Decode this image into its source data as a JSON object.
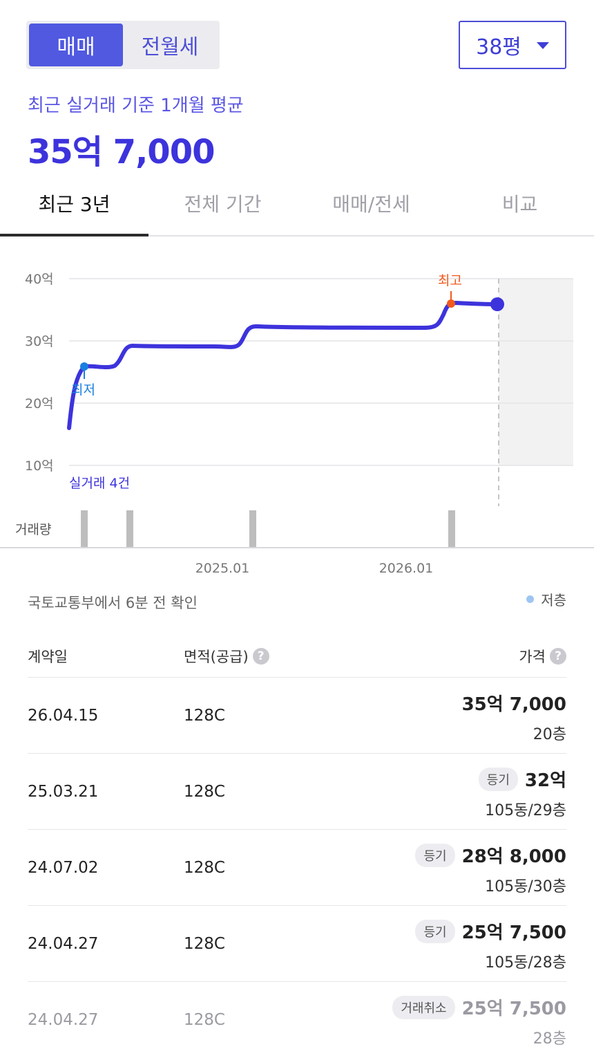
{
  "trade_toggle": {
    "sale": "매매",
    "rent": "전월세"
  },
  "size_select": {
    "value": "38평"
  },
  "summary": {
    "label": "최근 실거래 기준 1개월 평균",
    "price": "35억 7,000"
  },
  "period_tabs": [
    "최근 3년",
    "전체 기간",
    "매매/전세",
    "비교"
  ],
  "chart_data": {
    "type": "line",
    "y_axis": {
      "ticks": [
        "40억",
        "30억",
        "20억",
        "10억"
      ],
      "values": [
        40,
        30,
        20,
        10
      ],
      "unit": "억"
    },
    "x_axis": {
      "ticks": [
        "2025.01",
        "2026.01"
      ]
    },
    "series": [
      {
        "values_eok": [
          16,
          26,
          26,
          29,
          29,
          32,
          32,
          36,
          35.7
        ]
      }
    ],
    "markers": {
      "low": {
        "label": "최저",
        "value": 26
      },
      "high": {
        "label": "최고",
        "value": 36
      }
    },
    "annotation": "실거래 4건",
    "volume_label": "거래량",
    "colors": {
      "line": "#3d33dc",
      "low": "#1a7fe0",
      "high": "#f25a1d",
      "volume": "#bdbdbd"
    }
  },
  "source_text": "국토교통부에서 6분 전 확인",
  "legend": {
    "low_floor": "저층"
  },
  "table": {
    "headers": {
      "date": "계약일",
      "area": "면적(공급)",
      "price": "가격"
    },
    "rows": [
      {
        "date": "26.04.15",
        "area": "128C",
        "badge": "",
        "price": "35억 7,000",
        "floor": "20층"
      },
      {
        "date": "25.03.21",
        "area": "128C",
        "badge": "등기",
        "price": "32억",
        "floor": "105동/29층"
      },
      {
        "date": "24.07.02",
        "area": "128C",
        "badge": "등기",
        "price": "28억 8,000",
        "floor": "105동/30층"
      },
      {
        "date": "24.04.27",
        "area": "128C",
        "badge": "등기",
        "price": "25억 7,500",
        "floor": "105동/28층"
      },
      {
        "date": "24.04.27",
        "area": "128C",
        "badge": "거래취소",
        "price": "25억 7,500",
        "floor": "28층"
      }
    ]
  }
}
